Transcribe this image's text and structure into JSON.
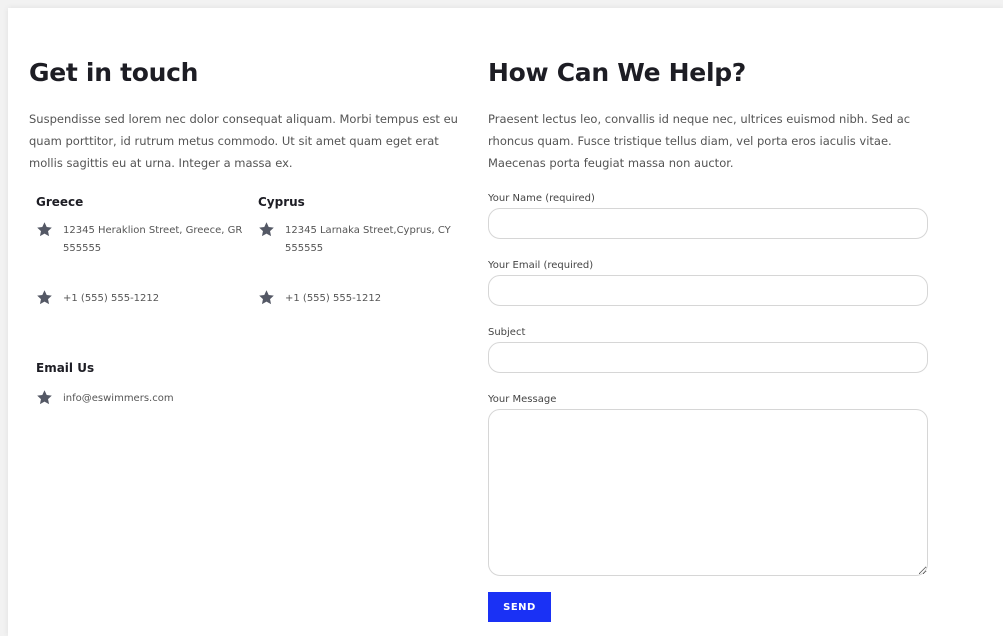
{
  "contact": {
    "title": "Get in touch",
    "intro": "Suspendisse sed lorem nec dolor consequat aliquam. Morbi tempus est eu quam porttitor, id rutrum metus commodo. Ut sit amet quam eget erat mollis sagittis eu at urna. Integer a massa ex.",
    "offices": [
      {
        "name": "Greece",
        "address": "12345 Heraklion Street, Greece, GR 555555",
        "phone": "+1 (555) 555-1212"
      },
      {
        "name": "Cyprus",
        "address": "12345 Larnaka Street,Cyprus, CY 555555",
        "phone": "+1 (555) 555-1212"
      }
    ],
    "email_title": "Email Us",
    "email": "info@eswimmers.com",
    "icon": "star-icon",
    "icon_color": "#545865"
  },
  "help": {
    "title": "How Can We Help?",
    "intro": "Praesent lectus leo, convallis id neque nec, ultrices euismod nibh. Sed ac rhoncus quam. Fusce tristique tellus diam, vel porta eros iaculis vitae. Maecenas porta feugiat massa non auctor.",
    "form": {
      "name_label": "Your Name (required)",
      "name_value": "",
      "email_label": "Your Email (required)",
      "email_value": "",
      "subject_label": "Subject",
      "subject_value": "",
      "message_label": "Your Message",
      "message_value": "",
      "send_label": "SEND",
      "send_color": "#1a31f5"
    }
  }
}
